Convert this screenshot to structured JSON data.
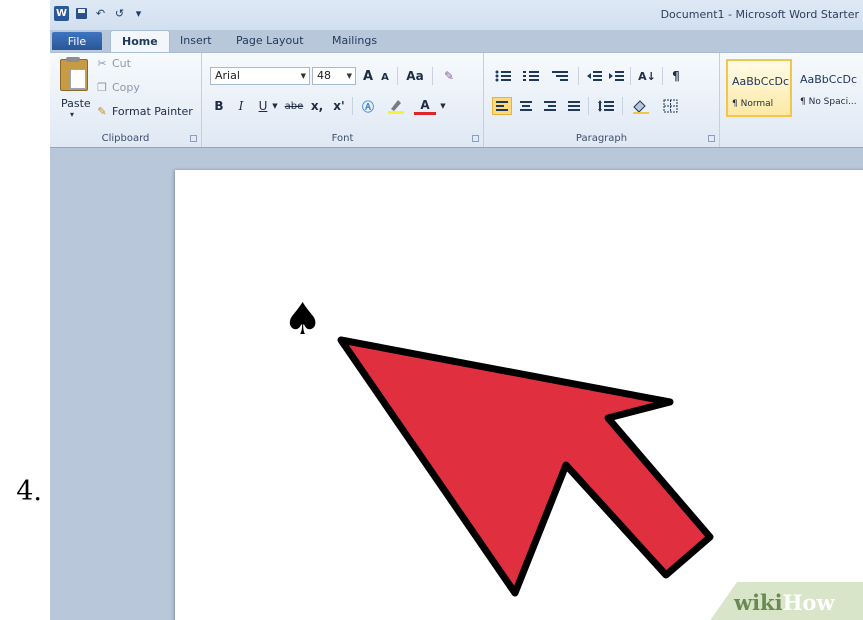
{
  "step": {
    "number": "4."
  },
  "window": {
    "title": "Document1 - Microsoft Word Starter"
  },
  "quick_access": {
    "logo": "W",
    "undo": "↶",
    "redo": "↺"
  },
  "tabs": {
    "file": "File",
    "home": "Home",
    "insert": "Insert",
    "page_layout": "Page Layout",
    "mailings": "Mailings"
  },
  "clipboard": {
    "paste": "Paste",
    "cut": "Cut",
    "copy": "Copy",
    "format_painter": "Format Painter",
    "label": "Clipboard"
  },
  "font": {
    "name": "Arial",
    "size": "48",
    "grow": "A",
    "shrink": "A",
    "change_case": "Aa",
    "bold": "B",
    "italic": "I",
    "underline": "U",
    "strike": "abe",
    "subscript": "x,",
    "superscript": "x'",
    "font_color": "A",
    "label": "Font"
  },
  "paragraph": {
    "sort": "A↓",
    "pilcrow": "¶",
    "label": "Paragraph"
  },
  "styles": [
    {
      "sample": "AaBbCcDc",
      "name": "¶ Normal"
    },
    {
      "sample": "AaBbCcDc",
      "name": "¶ No Spaci..."
    }
  ],
  "document": {
    "symbol": "♠"
  },
  "watermark": {
    "part1": "wiki",
    "part2": "How"
  },
  "colors": {
    "arrow": "#e03040",
    "ribbon_accent": "#2b5797",
    "watermark_bg": "#d6e4c6"
  }
}
